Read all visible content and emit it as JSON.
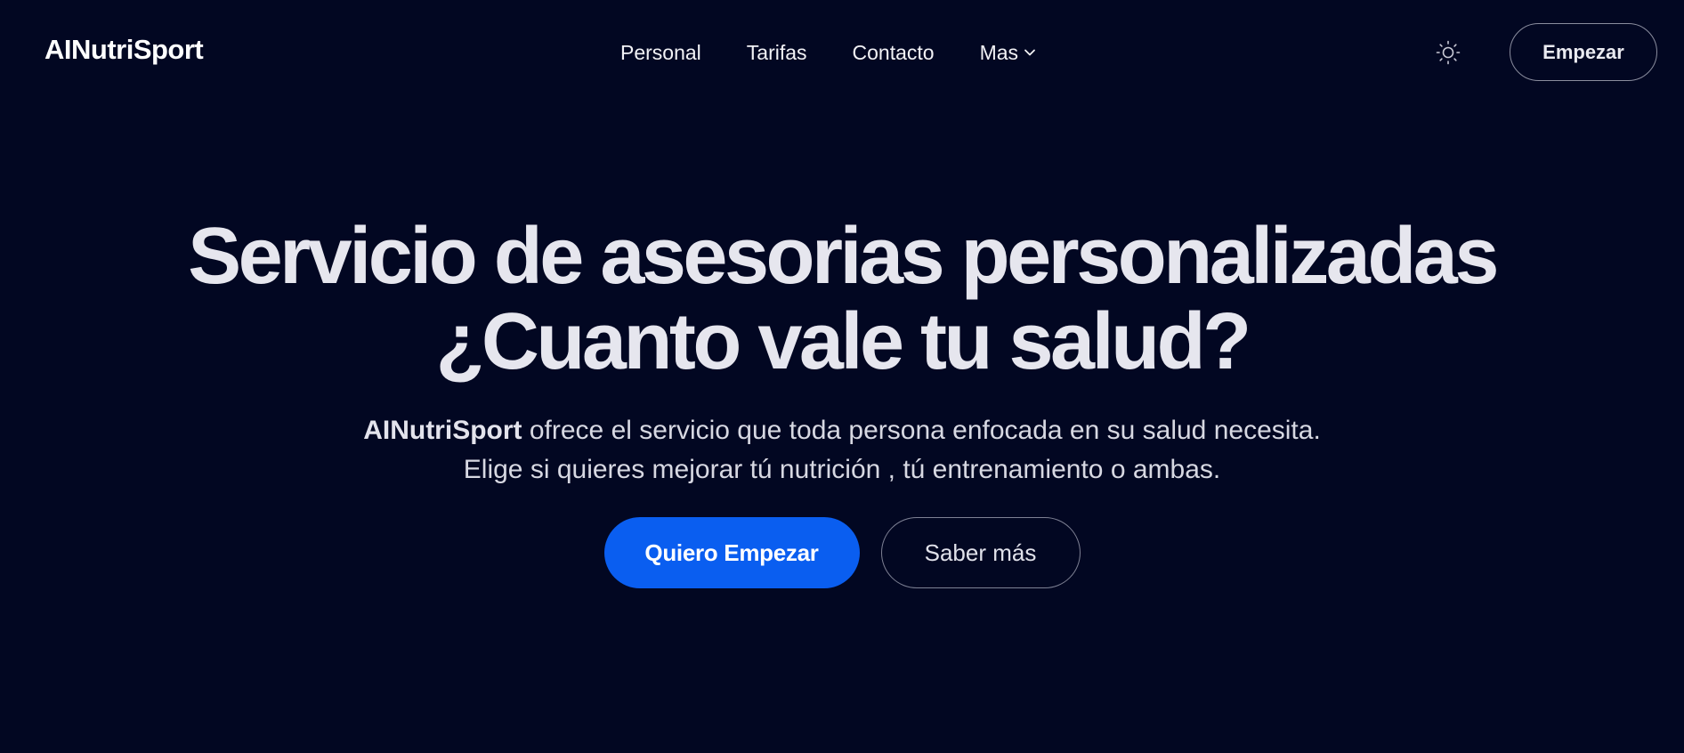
{
  "header": {
    "logo": "AINutriSport",
    "nav": [
      {
        "label": "Personal"
      },
      {
        "label": "Tarifas"
      },
      {
        "label": "Contacto"
      },
      {
        "label": "Mas",
        "icon": "chevron-down-icon"
      }
    ],
    "theme_toggle_icon": "sun-icon",
    "cta_label": "Empezar"
  },
  "hero": {
    "title_line1": "Servicio de asesorias personalizadas",
    "title_line2": "¿Cuanto vale tu salud?",
    "subtitle_brand": "AINutriSport",
    "subtitle_line1_rest": " ofrece el servicio que toda persona enfocada en su salud necesita.",
    "subtitle_line2": "Elige si quieres mejorar tú nutrición , tú entrenamiento o ambas.",
    "primary_button": "Quiero Empezar",
    "secondary_button": "Saber más"
  },
  "colors": {
    "background": "#020722",
    "primary_button": "#0a5ef0",
    "text": "#e6e6ee"
  }
}
